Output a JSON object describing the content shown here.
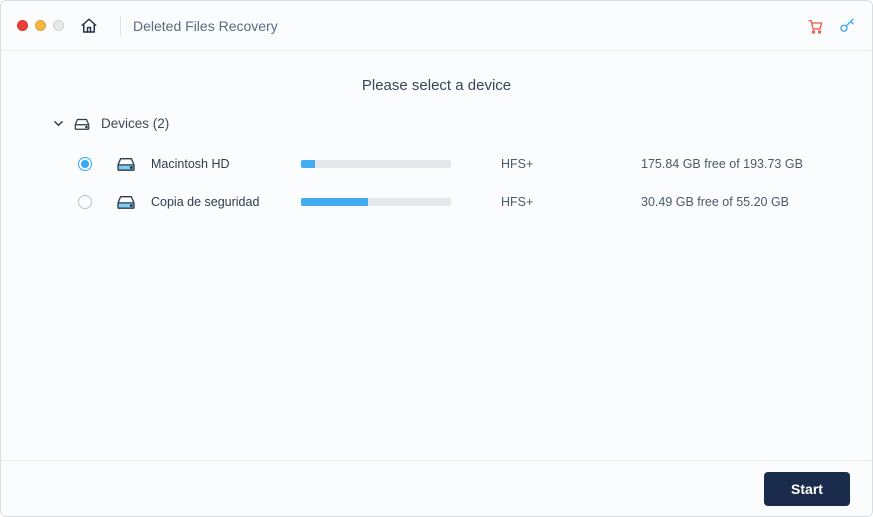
{
  "header": {
    "title": "Deleted Files Recovery"
  },
  "main": {
    "prompt": "Please select a device",
    "section_label": "Devices (2)"
  },
  "devices": [
    {
      "name": "Macintosh HD",
      "fs": "HFS+",
      "free_text": "175.84 GB free of 193.73 GB",
      "used_percent": 9.2,
      "selected": true
    },
    {
      "name": "Copia de seguridad",
      "fs": "HFS+",
      "free_text": "30.49 GB free of 55.20 GB",
      "used_percent": 44.8,
      "selected": false
    }
  ],
  "footer": {
    "start_label": "Start"
  },
  "icons": {
    "home": "home-icon",
    "cart": "cart-icon",
    "key": "key-icon",
    "device_section": "drive-icon",
    "chevron": "chevron-down-icon"
  }
}
